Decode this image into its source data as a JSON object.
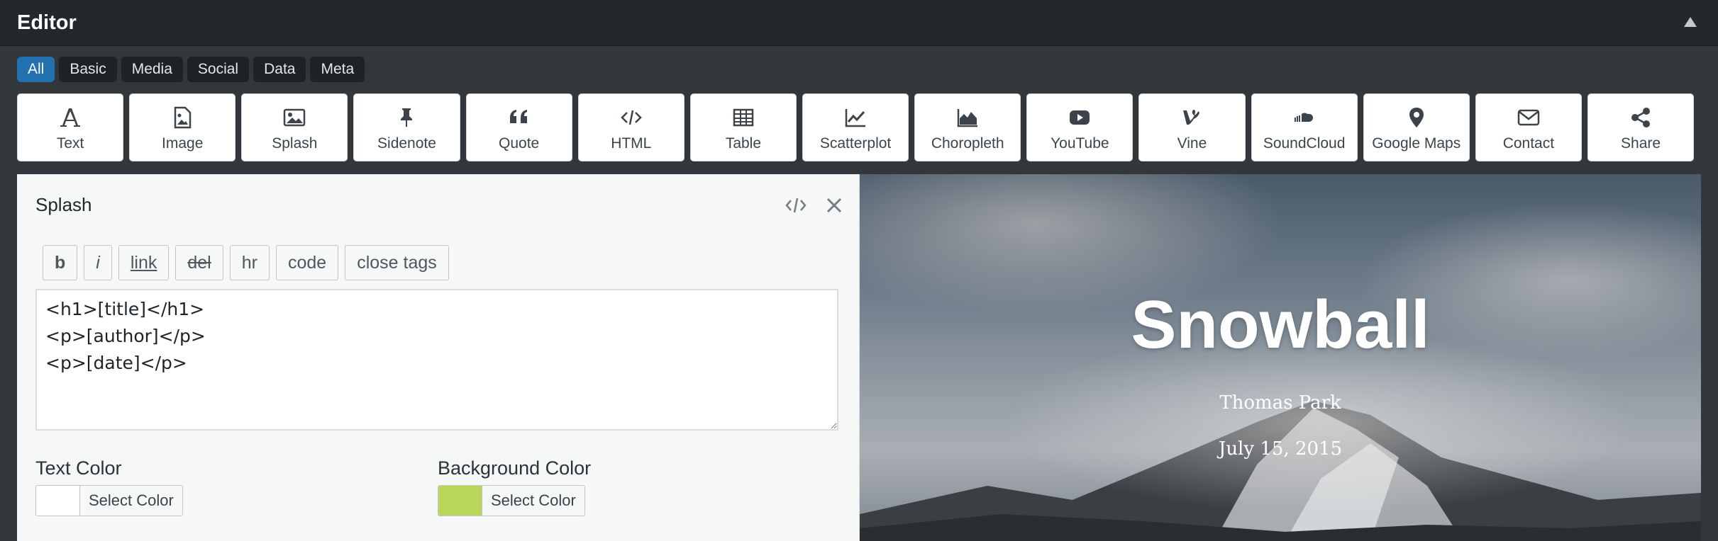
{
  "window": {
    "title": "Editor"
  },
  "filters": [
    {
      "label": "All",
      "active": true
    },
    {
      "label": "Basic"
    },
    {
      "label": "Media"
    },
    {
      "label": "Social"
    },
    {
      "label": "Data"
    },
    {
      "label": "Meta"
    }
  ],
  "blocks": [
    {
      "label": "Text",
      "icon": "text-icon"
    },
    {
      "label": "Image",
      "icon": "image-icon"
    },
    {
      "label": "Splash",
      "icon": "splash-icon"
    },
    {
      "label": "Sidenote",
      "icon": "pin-icon"
    },
    {
      "label": "Quote",
      "icon": "quote-icon"
    },
    {
      "label": "HTML",
      "icon": "code-icon"
    },
    {
      "label": "Table",
      "icon": "table-icon"
    },
    {
      "label": "Scatterplot",
      "icon": "scatterplot-icon"
    },
    {
      "label": "Choropleth",
      "icon": "area-chart-icon"
    },
    {
      "label": "YouTube",
      "icon": "youtube-icon"
    },
    {
      "label": "Vine",
      "icon": "vine-icon"
    },
    {
      "label": "SoundCloud",
      "icon": "soundcloud-icon"
    },
    {
      "label": "Google Maps",
      "icon": "map-marker-icon"
    },
    {
      "label": "Contact",
      "icon": "envelope-icon"
    },
    {
      "label": "Share",
      "icon": "share-icon"
    }
  ],
  "panel": {
    "title": "Splash",
    "quicktags": [
      "b",
      "i",
      "link",
      "del",
      "hr",
      "code",
      "close tags"
    ],
    "code": "<h1>[title]</h1>\n<p>[author]</p>\n<p>[date]</p>",
    "text_color": {
      "label": "Text Color",
      "button": "Select Color",
      "value": "#ffffff"
    },
    "background_color": {
      "label": "Background Color",
      "button": "Select Color",
      "value": "#b9d65a"
    }
  },
  "preview": {
    "title": "Snowball",
    "author": "Thomas Park",
    "date": "July 15, 2015"
  }
}
